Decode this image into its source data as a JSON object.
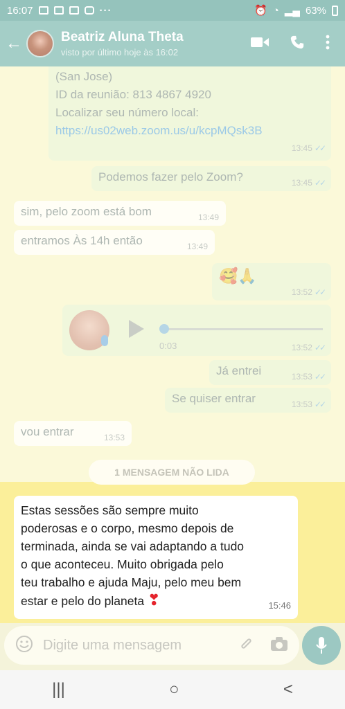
{
  "status_bar": {
    "time": "16:07",
    "battery": "63%",
    "more": "···"
  },
  "header": {
    "back_label": "←",
    "contact_name": "Beatriz Aluna Theta",
    "last_seen": "visto por último hoje às 16:02"
  },
  "messages": [
    {
      "side": "out",
      "lines": [
        "(San Jose)",
        "ID da reunião: 813 4867 4920",
        "Localizar seu número local:"
      ],
      "link": "https://us02web.zoom.us/u/kcpMQsk3B",
      "time": "13:45",
      "ticks": "✓✓"
    },
    {
      "side": "out",
      "text": "Podemos fazer pelo Zoom?",
      "time": "13:45",
      "ticks": "✓✓"
    },
    {
      "side": "in",
      "text": "sim, pelo zoom está bom",
      "time": "13:49"
    },
    {
      "side": "in",
      "text": "entramos Às 14h então",
      "time": "13:49"
    },
    {
      "side": "out",
      "text": "🥰🙏",
      "time": "13:52",
      "ticks": "✓✓"
    },
    {
      "side": "out",
      "type": "voice",
      "duration": "0:03",
      "progress": 0,
      "time": "13:52",
      "ticks": "✓✓"
    },
    {
      "side": "out",
      "text": "Já entrei",
      "time": "13:53",
      "ticks": "✓✓"
    },
    {
      "side": "out",
      "text": "Se quiser entrar",
      "time": "13:53",
      "ticks": "✓✓"
    },
    {
      "side": "in",
      "text": "vou entrar",
      "time": "13:53"
    }
  ],
  "unread_label": "1 MENSAGEM NÃO LIDA",
  "last_message": {
    "lines": [
      "Estas sessões são sempre muito",
      "poderosas e o corpo, mesmo depois de",
      "terminada,  ainda se vai adaptando a tudo",
      "o que aconteceu. Muito obrigada  pelo",
      "teu trabalho e ajuda Maju, pelo meu bem",
      "estar e pelo do planeta"
    ],
    "emoji": "❣",
    "time": "15:46"
  },
  "composer": {
    "placeholder": "Digite uma mensagem"
  },
  "nav": {
    "recents": "|||",
    "home": "○",
    "back": "<"
  },
  "colors": {
    "header": "#a4cec7",
    "unread_band": "#fbef9a",
    "mic": "#9cc8c2"
  }
}
